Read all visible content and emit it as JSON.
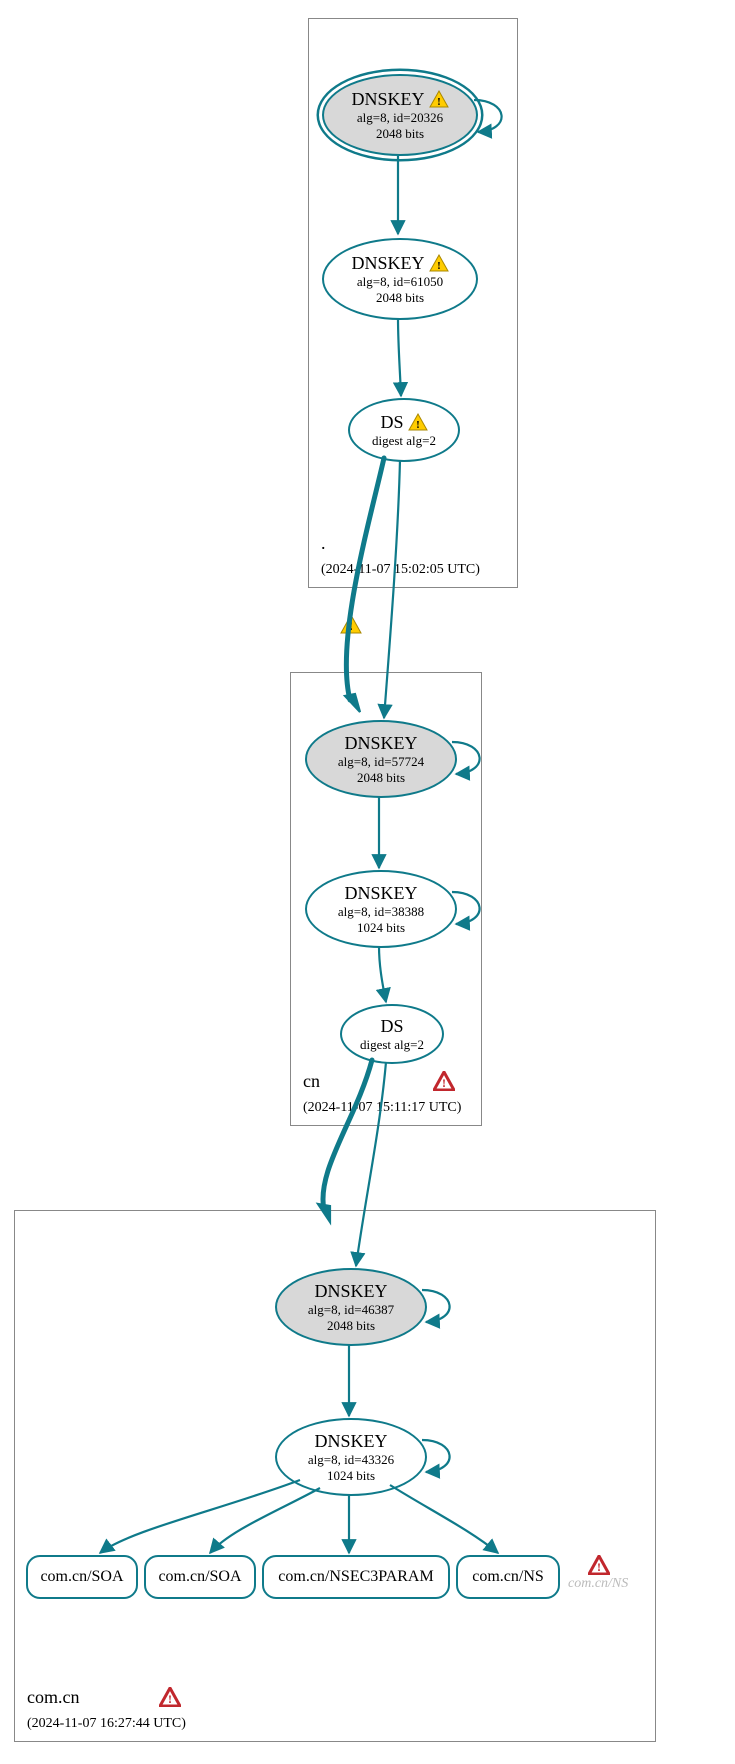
{
  "zones": {
    "root": {
      "name": ".",
      "timestamp": "(2024-11-07 15:02:05 UTC)"
    },
    "cn": {
      "name": "cn",
      "timestamp": "(2024-11-07 15:11:17 UTC)"
    },
    "comcn": {
      "name": "com.cn",
      "timestamp": "(2024-11-07 16:27:44 UTC)"
    }
  },
  "nodes": {
    "root_ksk": {
      "title": "DNSKEY",
      "line2": "alg=8, id=20326",
      "line3": "2048 bits",
      "warn": true
    },
    "root_zsk": {
      "title": "DNSKEY",
      "line2": "alg=8, id=61050",
      "line3": "2048 bits",
      "warn": true
    },
    "root_ds": {
      "title": "DS",
      "line2": "digest alg=2",
      "warn": true
    },
    "cn_ksk": {
      "title": "DNSKEY",
      "line2": "alg=8, id=57724",
      "line3": "2048 bits"
    },
    "cn_zsk": {
      "title": "DNSKEY",
      "line2": "alg=8, id=38388",
      "line3": "1024 bits"
    },
    "cn_ds": {
      "title": "DS",
      "line2": "digest alg=2"
    },
    "comcn_ksk": {
      "title": "DNSKEY",
      "line2": "alg=8, id=46387",
      "line3": "2048 bits"
    },
    "comcn_zsk": {
      "title": "DNSKEY",
      "line2": "alg=8, id=43326",
      "line3": "1024 bits"
    },
    "rr_soa1": {
      "label": "com.cn/SOA"
    },
    "rr_soa2": {
      "label": "com.cn/SOA"
    },
    "rr_nsec3": {
      "label": "com.cn/NSEC3PARAM"
    },
    "rr_ns": {
      "label": "com.cn/NS"
    },
    "rr_ns_ghost": {
      "label": "com.cn/NS"
    }
  },
  "colors": {
    "teal": "#0f7a8a"
  }
}
